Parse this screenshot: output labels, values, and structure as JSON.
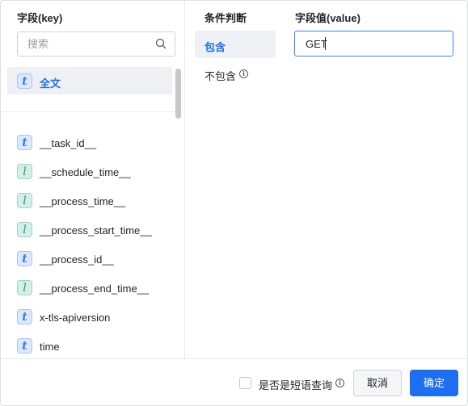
{
  "columns": {
    "key_title": "字段(key)",
    "condition_title": "条件判断",
    "value_title": "字段值(value)"
  },
  "search": {
    "placeholder": "搜索",
    "icon": "search-icon"
  },
  "fulltext": {
    "type": "t",
    "label": "全文"
  },
  "fields": [
    {
      "type": "t",
      "label": "__task_id__"
    },
    {
      "type": "l",
      "label": "__schedule_time__"
    },
    {
      "type": "l",
      "label": "__process_time__"
    },
    {
      "type": "l",
      "label": "__process_start_time__"
    },
    {
      "type": "t",
      "label": "__process_id__"
    },
    {
      "type": "l",
      "label": "__process_end_time__"
    },
    {
      "type": "t",
      "label": "x-tls-apiversion"
    },
    {
      "type": "t",
      "label": "time"
    }
  ],
  "conditions": [
    {
      "label": "包含",
      "active": true
    },
    {
      "label": "不包含",
      "active": false,
      "info_icon": "info-icon"
    }
  ],
  "value": {
    "current": "GET"
  },
  "footer": {
    "phrase_query_label": "是否是短语查询",
    "phrase_query_checked": false,
    "cancel_label": "取消",
    "ok_label": "确定"
  },
  "colors": {
    "accent": "#1d6ff2",
    "type_t": "#3a7ae8",
    "type_l": "#2a9a7c"
  }
}
